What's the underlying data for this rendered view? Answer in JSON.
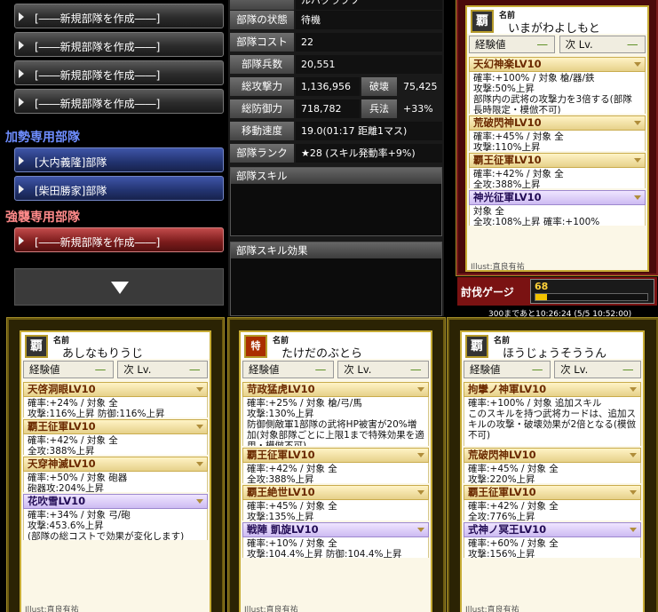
{
  "left": {
    "slots": [
      {
        "text": "[――新規部隊を作成――]",
        "style": "dark"
      },
      {
        "text": "[――新規部隊を作成――]",
        "style": "dark"
      },
      {
        "text": "[――新規部隊を作成――]",
        "style": "dark"
      },
      {
        "text": "[――新規部隊を作成――]",
        "style": "dark"
      }
    ],
    "support_header": "加勢専用部隊",
    "support_slots": [
      {
        "text": "[大内義隆]部隊"
      },
      {
        "text": "[柴田勝家]部隊"
      }
    ],
    "raid_header": "強襲専用部隊",
    "raid_slots": [
      {
        "text": "[――新規部隊を作成――]"
      }
    ],
    "scroll_down": "▼"
  },
  "stats": {
    "rows": [
      {
        "label": "",
        "value": "ルバクラフソ"
      },
      {
        "label": "部隊の状態",
        "value": "待機"
      },
      {
        "label": "部隊コスト",
        "value": "22"
      },
      {
        "label": "部隊兵数",
        "value": "20,551"
      },
      {
        "label": "総攻撃力",
        "value": "1,136,956",
        "sublabel": "破壊",
        "subvalue": "75,425"
      },
      {
        "label": "総防御力",
        "value": "718,782",
        "sublabel": "兵法",
        "subvalue": "+33%"
      },
      {
        "label": "移動速度",
        "value": "19.0(01:17 距離1マス)"
      },
      {
        "label": "部隊ランク",
        "value": "★28 (スキル発動率+9%)"
      }
    ],
    "skill_panel": "部隊スキル",
    "skill_effect_panel": "部隊スキル効果"
  },
  "colors": {
    "accent_green": "#3f7d00",
    "skill_title": "#6b2a00",
    "gold": "#c7ac35"
  },
  "cards": [
    {
      "id": "top",
      "emblem": "覇",
      "name_label": "名前",
      "name": "いまがわよしもと",
      "exp_label": "経験値",
      "exp_val": "―",
      "next_label": "次 Lv.",
      "next_val": "―",
      "skills": [
        {
          "title": "天幻神楽LV10",
          "purple": false,
          "body": "確率:+100% / 対象 槍/器/鉄\n攻撃:50%上昇\n部隊内の武将の攻撃力を3倍する(部隊長時限定・模倣不可)"
        },
        {
          "title": "荒破閃神LV10",
          "purple": false,
          "body": "確率:+45% / 対象 全\n攻撃:110%上昇"
        },
        {
          "title": "覇王征軍LV10",
          "purple": false,
          "body": "確率:+42% / 対象 全\n全攻:388%上昇"
        },
        {
          "title": "神光征軍LV10",
          "purple": true,
          "body": "対象 全\n全攻:108%上昇  確率:+100%"
        }
      ],
      "illust": "Illust:直良有祐"
    },
    {
      "id": "c1",
      "emblem": "覇",
      "name_label": "名前",
      "name": "あしなもりうじ",
      "exp_label": "経験値",
      "exp_val": "―",
      "next_label": "次 Lv.",
      "next_val": "―",
      "skills": [
        {
          "title": "天啓洞眼LV10",
          "purple": false,
          "body": "確率:+24% / 対象 全\n攻撃:116%上昇 防御:116%上昇"
        },
        {
          "title": "覇王征軍LV10",
          "purple": false,
          "body": "確率:+42% / 対象 全\n全攻:388%上昇"
        },
        {
          "title": "天穿神滅LV10",
          "purple": false,
          "body": "確率:+50% / 対象 砲器\n砲器攻:204%上昇"
        },
        {
          "title": "花吹雪LV10",
          "purple": true,
          "body": "確率:+34% / 対象 弓/砲\n攻撃:453.6%上昇\n(部隊の総コストで効果が変化します)"
        }
      ],
      "illust": "Illust:直良有祐"
    },
    {
      "id": "c2",
      "emblem": "特",
      "name_label": "名前",
      "name": "たけだのぶとら",
      "exp_label": "経験値",
      "exp_val": "―",
      "next_label": "次 Lv.",
      "next_val": "―",
      "skills": [
        {
          "title": "苛政猛虎LV10",
          "purple": false,
          "body": "確率:+25% / 対象 槍/弓/馬\n攻撃:130%上昇\n防御側敵軍1部隊の武将HP被害が20%増加(対象部隊ごとに上限1まで特殊効果を適用・模倣不可)"
        },
        {
          "title": "覇王征軍LV10",
          "purple": false,
          "body": "確率:+42% / 対象 全\n全攻:388%上昇"
        },
        {
          "title": "覇王絶世LV10",
          "purple": false,
          "body": "確率:+45% / 対象 全\n攻撃:135%上昇"
        },
        {
          "title": "戦陣 凱旋LV10",
          "purple": true,
          "body": "確率:+10% / 対象 全\n攻撃:104.4%上昇 防御:104.4%上昇"
        }
      ],
      "illust": "Illust:直良有祐"
    },
    {
      "id": "c3",
      "emblem": "覇",
      "name_label": "名前",
      "name": "ほうじょうそううん",
      "exp_label": "経験値",
      "exp_val": "―",
      "next_label": "次 Lv.",
      "next_val": "―",
      "skills": [
        {
          "title": "拘攣ノ神軍LV10",
          "purple": false,
          "body": "確率:+100% / 対象 追加スキル\nこのスキルを持つ武将カードは、追加スキルの攻撃・破壊効果が2倍となる(模倣不可)"
        },
        {
          "title": "荒破閃神LV10",
          "purple": false,
          "body": "確率:+45% / 対象 全\n攻撃:220%上昇"
        },
        {
          "title": "覇王征軍LV10",
          "purple": false,
          "body": "確率:+42% / 対象 全\n全攻:776%上昇"
        },
        {
          "title": "式神ノ冥王LV10",
          "purple": true,
          "body": "確率:+60% / 対象 全\n攻撃:156%上昇"
        }
      ],
      "illust": "Illust:直良有祐"
    }
  ],
  "gauge": {
    "label": "討伐ゲージ",
    "value": "68",
    "fraction": 0.1,
    "time": "300まであと10:26:24 (5/5 10:52:00)"
  }
}
